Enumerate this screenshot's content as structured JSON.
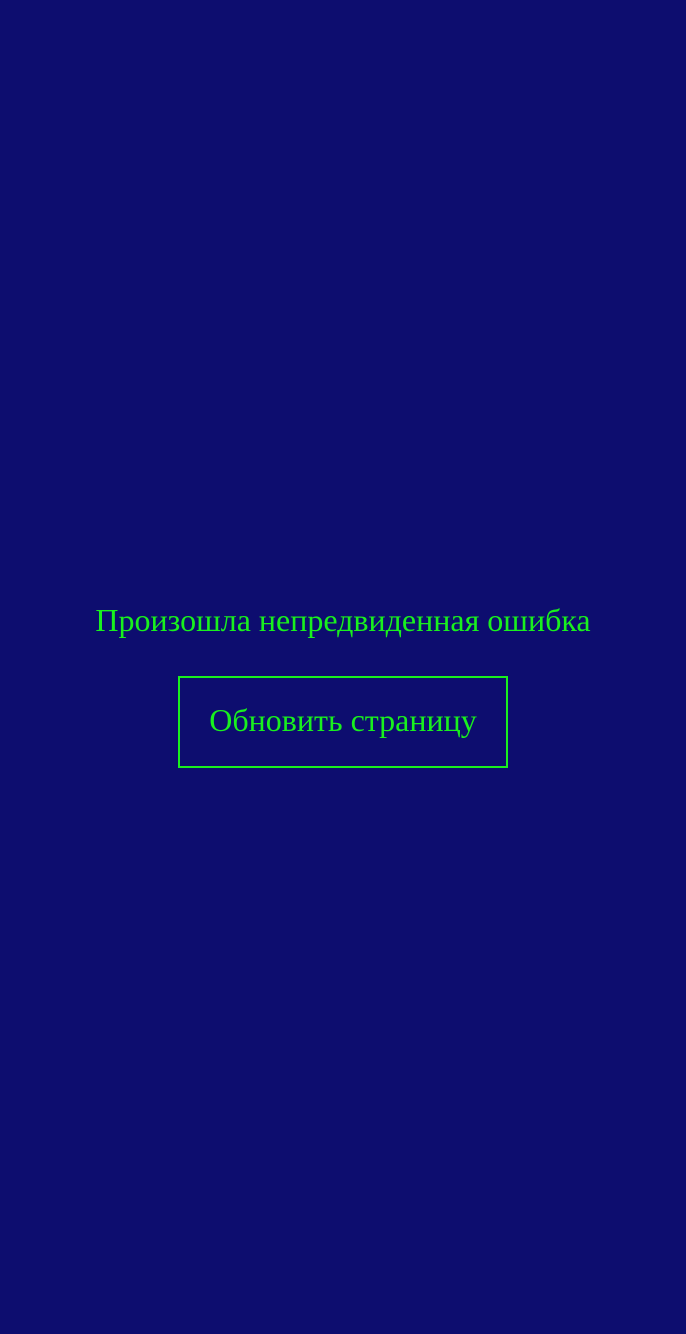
{
  "error": {
    "message": "Произошла непредвиденная ошибка",
    "reload_label": "Обновить страницу"
  },
  "colors": {
    "background": "#0d0d6f",
    "accent": "#19f01e"
  }
}
